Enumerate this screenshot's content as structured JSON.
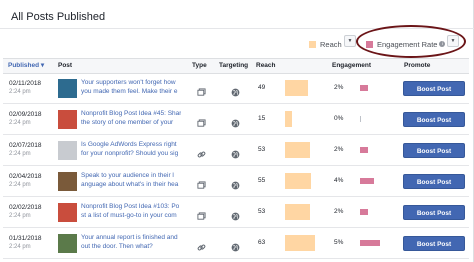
{
  "page": {
    "title": "All Posts Published"
  },
  "legend": {
    "reach_label": "Reach",
    "reach_color": "#ffd6a3",
    "engagement_label": "Engagement Rate",
    "engagement_color": "#d77a9a",
    "info_icon": "info-icon"
  },
  "table": {
    "headers": {
      "published": "Published",
      "post": "Post",
      "type": "Type",
      "targeting": "Targeting",
      "reach": "Reach",
      "engagement": "Engagement",
      "promote": "Promote"
    },
    "rows": [
      {
        "date": "02/11/2018",
        "time": "2:24 pm",
        "line1": "Your supporters won't forget how",
        "line2": "you made them feel. Make their e",
        "type_icon": "photo-icon",
        "reach": "49",
        "reach_pct": 0.58,
        "engagement": "2%",
        "eng_pct": 0.4,
        "boost_label": "Boost Post",
        "thumb_color": "#2d6b8f"
      },
      {
        "date": "02/09/2018",
        "time": "2:24 pm",
        "line1": "Nonprofit Blog Post Idea #45: Shar",
        "line2": "the story of one member of your",
        "type_icon": "photo-icon",
        "reach": "15",
        "reach_pct": 0.18,
        "engagement": "0%",
        "eng_pct": 0.0,
        "boost_label": "Boost Post",
        "thumb_color": "#c94d3d"
      },
      {
        "date": "02/07/2018",
        "time": "2:24 pm",
        "line1": "Is Google AdWords Express right",
        "line2": "for your nonprofit? Should you sig",
        "type_icon": "link-icon",
        "reach": "53",
        "reach_pct": 0.62,
        "engagement": "2%",
        "eng_pct": 0.4,
        "boost_label": "Boost Post",
        "thumb_color": "#c8cbd0"
      },
      {
        "date": "02/04/2018",
        "time": "2:24 pm",
        "line1": "Speak to your audience in their l",
        "line2": "anguage about what's in their hea",
        "type_icon": "photo-icon",
        "reach": "55",
        "reach_pct": 0.64,
        "engagement": "4%",
        "eng_pct": 0.7,
        "boost_label": "Boost Post",
        "thumb_color": "#7a5a3a"
      },
      {
        "date": "02/02/2018",
        "time": "2:24 pm",
        "line1": "Nonprofit Blog Post Idea #103: Po",
        "line2": "st a list of must-go-to in your com",
        "type_icon": "photo-icon",
        "reach": "53",
        "reach_pct": 0.62,
        "engagement": "2%",
        "eng_pct": 0.4,
        "boost_label": "Boost Post",
        "thumb_color": "#c94d3d"
      },
      {
        "date": "01/31/2018",
        "time": "2:24 pm",
        "line1": "Your annual report is finished and",
        "line2": "out the door. Then what?",
        "type_icon": "link-icon",
        "reach": "63",
        "reach_pct": 0.74,
        "engagement": "5%",
        "eng_pct": 1.0,
        "boost_label": "Boost Post",
        "thumb_color": "#5b7a4a"
      }
    ]
  }
}
